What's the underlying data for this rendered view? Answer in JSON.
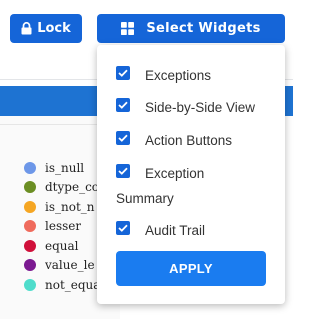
{
  "toolbar": {
    "lock_label": "Lock",
    "select_widgets_label": "Select Widgets"
  },
  "legend": {
    "items": [
      {
        "label": "is_null",
        "color": "#6d97e8"
      },
      {
        "label": "dtype_co",
        "color": "#6b8e23"
      },
      {
        "label": "is_not_n",
        "color": "#f5a623"
      },
      {
        "label": "lesser",
        "color": "#ef6b5d"
      },
      {
        "label": "equal",
        "color": "#d0103a"
      },
      {
        "label": "value_le",
        "color": "#7b1a91"
      },
      {
        "label": "not_equal",
        "color": "#4fdccb"
      }
    ]
  },
  "widgets_menu": {
    "items": [
      {
        "label": "Exceptions",
        "checked": true
      },
      {
        "label": "Side-by-Side View",
        "checked": true
      },
      {
        "label": "Action Buttons",
        "checked": true
      },
      {
        "label_line1": "Exception",
        "label_line2": "Summary",
        "checked": true
      },
      {
        "label": "Audit Trail",
        "checked": true
      }
    ],
    "apply_label": "APPLY"
  },
  "colors": {
    "primary": "#1565d8",
    "apply": "#1a7cf0"
  }
}
